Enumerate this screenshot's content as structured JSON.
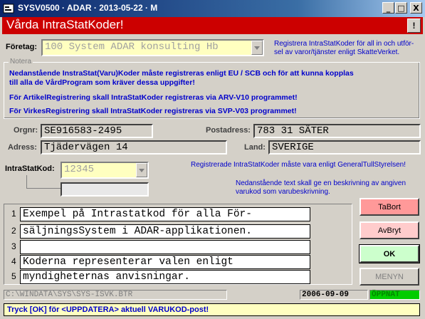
{
  "window": {
    "title": "SYSV0500 · ADAR · 2013-05-22 · M",
    "minimize": "_",
    "maximize": "□",
    "close": "X"
  },
  "header": {
    "title": "Vårda IntraStatKoder!",
    "alert_label": "!"
  },
  "company": {
    "label": "Företag:",
    "value": "100 System ADAR konsulting Hb",
    "info_line1": "Registrera IntraStatKoder för all in och utför-",
    "info_line2": "sel av varor/tjänster enligt SkatteVerket."
  },
  "notera": {
    "legend": "Notera",
    "line1": "Nedanstående InstraStat(Varu)Koder måste registreras enligt EU / SCB och för att kunna kopplas",
    "line2": "till alla de VårdProgram som kräver dessa uppgifter!",
    "line3": "För ArtikelRegistrering skall IntraStatKoder registreras via ARV-V10 programmet!",
    "line4": "För VirkesRegistrering skall IntraStatKoder registreras via SVP-V03 programmet!"
  },
  "details": {
    "orgnr_label": "Orgnr:",
    "orgnr_value": "SE916583-2495",
    "postadress_label": "Postadress:",
    "postadress_value": "783 31  SÄTER",
    "adress_label": "Adress:",
    "adress_value": "Tjädervägen 14",
    "land_label": "Land:",
    "land_value": "SVERIGE"
  },
  "intrastat": {
    "label": "IntraStatKod:",
    "value": "12345",
    "info_right": "Registrerade IntraStatKoder måste vara enligt GeneralTullStyrelsen!",
    "desc_line1": "Nedanstående text skall ge en beskrivning av angiven",
    "desc_line2": "varukod som varubeskrivning."
  },
  "description_lines": [
    {
      "num": "1",
      "text": "Exempel på Intrastatkod för alla För-"
    },
    {
      "num": "2",
      "text": "säljningsSystem i ADAR-applikationen."
    },
    {
      "num": "3",
      "text": ""
    },
    {
      "num": "4",
      "text": "Koderna representerar valen enligt"
    },
    {
      "num": "5",
      "text": "myndigheternas anvisningar."
    }
  ],
  "buttons": {
    "tabort": "TaBort",
    "avbryt": "AvBryt",
    "ok": "OK",
    "menyn": "MENYN"
  },
  "status": {
    "path": "C:\\WINDATA\\SYS\\SYS-ISVK.BTR",
    "date": "2006-09-09",
    "state": "ÖPPNAT"
  },
  "message": "Tryck [OK] för <UPPDATERA> aktuell VARUKOD-post!",
  "colors": {
    "header_red": "#cc0000",
    "info_blue": "#0000cc",
    "input_yellow": "#ffffc0",
    "tabort_red": "#ff9999",
    "avbryt_pink": "#ffcccc",
    "ok_green": "#ccffcc",
    "status_green": "#00cc00"
  }
}
